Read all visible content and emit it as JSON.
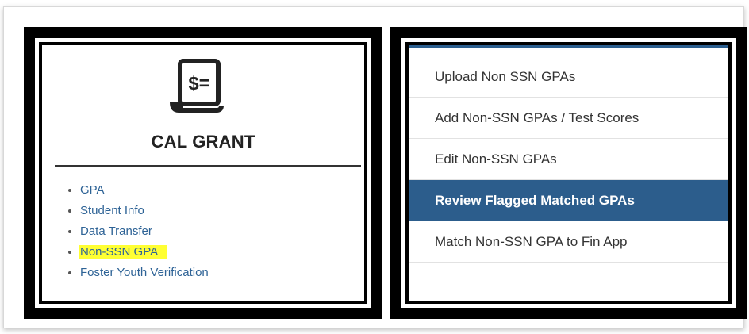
{
  "cal_grant": {
    "icon": "receipt-dollar-icon",
    "icon_text": "$=",
    "title": "CAL GRANT",
    "links": [
      {
        "label": "GPA",
        "highlighted": false
      },
      {
        "label": "Student Info",
        "highlighted": false
      },
      {
        "label": "Data Transfer",
        "highlighted": false
      },
      {
        "label": "Non-SSN GPA",
        "highlighted": true
      },
      {
        "label": "Foster Youth Verification",
        "highlighted": false
      }
    ]
  },
  "non_ssn_menu": {
    "items": [
      {
        "label": "Upload Non SSN GPAs",
        "active": false
      },
      {
        "label": "Add Non-SSN GPAs / Test Scores",
        "active": false
      },
      {
        "label": "Edit Non-SSN GPAs",
        "active": false
      },
      {
        "label": "Review Flagged Matched GPAs",
        "active": true
      },
      {
        "label": "Match Non-SSN GPA to Fin App",
        "active": false
      }
    ]
  },
  "colors": {
    "accent": "#2c5d8c",
    "link": "#2e6396",
    "highlight": "#ffff33"
  }
}
